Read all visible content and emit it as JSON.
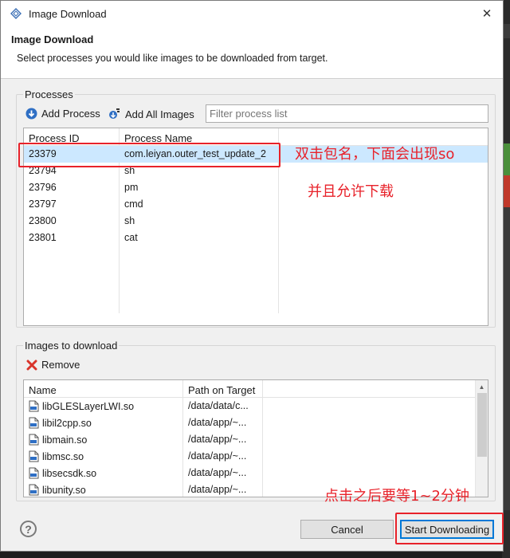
{
  "window": {
    "title": "Image Download",
    "close_glyph": "✕"
  },
  "header": {
    "title": "Image Download",
    "description": "Select processes you would like images to be downloaded from target."
  },
  "processes": {
    "group_label": "Processes",
    "add_process": "Add Process",
    "add_all_images": "Add All Images",
    "filter_placeholder": "Filter process list",
    "columns": [
      "Process ID",
      "Process Name"
    ],
    "rows": [
      {
        "pid": "23379",
        "name": "com.leiyan.outer_test_update_2",
        "selected": true
      },
      {
        "pid": "23794",
        "name": "sh"
      },
      {
        "pid": "23796",
        "name": "pm"
      },
      {
        "pid": "23797",
        "name": "cmd"
      },
      {
        "pid": "23800",
        "name": "sh"
      },
      {
        "pid": "23801",
        "name": "cat"
      }
    ]
  },
  "images": {
    "group_label": "Images to download",
    "remove": "Remove",
    "columns": [
      "Name",
      "Path on Target"
    ],
    "rows": [
      {
        "name": "libGLESLayerLWI.so",
        "path": "/data/data/c..."
      },
      {
        "name": "libil2cpp.so",
        "path": "/data/app/~..."
      },
      {
        "name": "libmain.so",
        "path": "/data/app/~..."
      },
      {
        "name": "libmsc.so",
        "path": "/data/app/~..."
      },
      {
        "name": "libsecsdk.so",
        "path": "/data/app/~..."
      },
      {
        "name": "libunity.so",
        "path": "/data/app/~..."
      }
    ]
  },
  "footer": {
    "help_glyph": "?",
    "cancel": "Cancel",
    "start": "Start Downloading"
  },
  "annotations": {
    "line1": "双击包名，下面会出现so",
    "line2": "并且允许下载",
    "line3": "点击之后要等1~2分钟"
  },
  "colors": {
    "annotation": "#e8222a",
    "selection": "#cce8ff",
    "accent": "#0078d7"
  }
}
